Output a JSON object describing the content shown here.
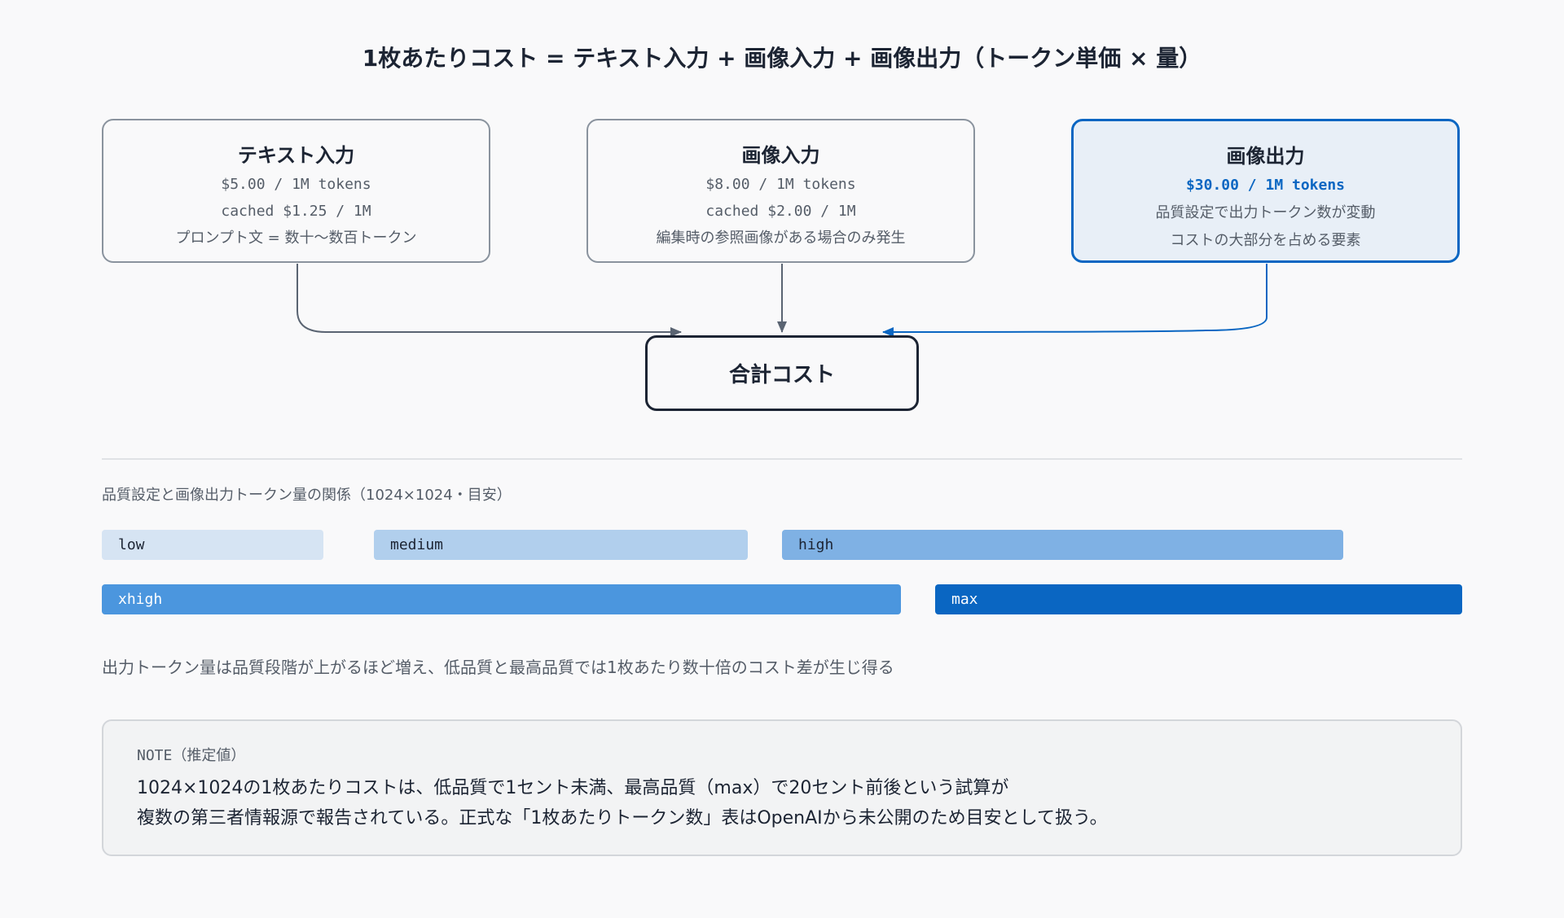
{
  "title": "1枚あたりコスト = テキスト入力 + 画像入力 + 画像出力（トークン単価 × 量）",
  "boxes": [
    {
      "title": "テキスト入力",
      "price": "$5.00 / 1M tokens",
      "cached": "cached $1.25 / 1M",
      "note": "プロンプト文 = 数十〜数百トークン"
    },
    {
      "title": "画像入力",
      "price": "$8.00 / 1M tokens",
      "cached": "cached $2.00 / 1M",
      "note": "編集時の参照画像がある場合のみ発生"
    },
    {
      "title": "画像出力",
      "price": "$30.00 / 1M tokens",
      "desc1": "品質設定で出力トークン数が変動",
      "desc2": "コストの大部分を占める要素"
    }
  ],
  "total": {
    "label": "合計コスト"
  },
  "quality": {
    "label": "品質設定と画像出力トークン量の関係（1024×1024・目安）",
    "levels": [
      {
        "name": "low"
      },
      {
        "name": "medium"
      },
      {
        "name": "high"
      },
      {
        "name": "xhigh"
      },
      {
        "name": "max"
      }
    ],
    "caption": "出力トークン量は品質段階が上がるほど増え、低品質と最高品質では1枚あたり数十倍のコスト差が生じ得る"
  },
  "note": {
    "label": "NOTE（推定値）",
    "line1": "1024×1024の1枚あたりコストは、低品質で1セント未満、最高品質（max）で20セント前後という試算が",
    "line2": "複数の第三者情報源で報告されている。正式な「1枚あたりトークン数」表はOpenAIから未公開のため目安として扱う。"
  },
  "colors": {
    "accent": "#0a66c2",
    "low": "#d6e4f3",
    "medium": "#b1cfed",
    "high": "#7fb1e4",
    "xhigh": "#4b96de",
    "max": "#0a66c2"
  }
}
